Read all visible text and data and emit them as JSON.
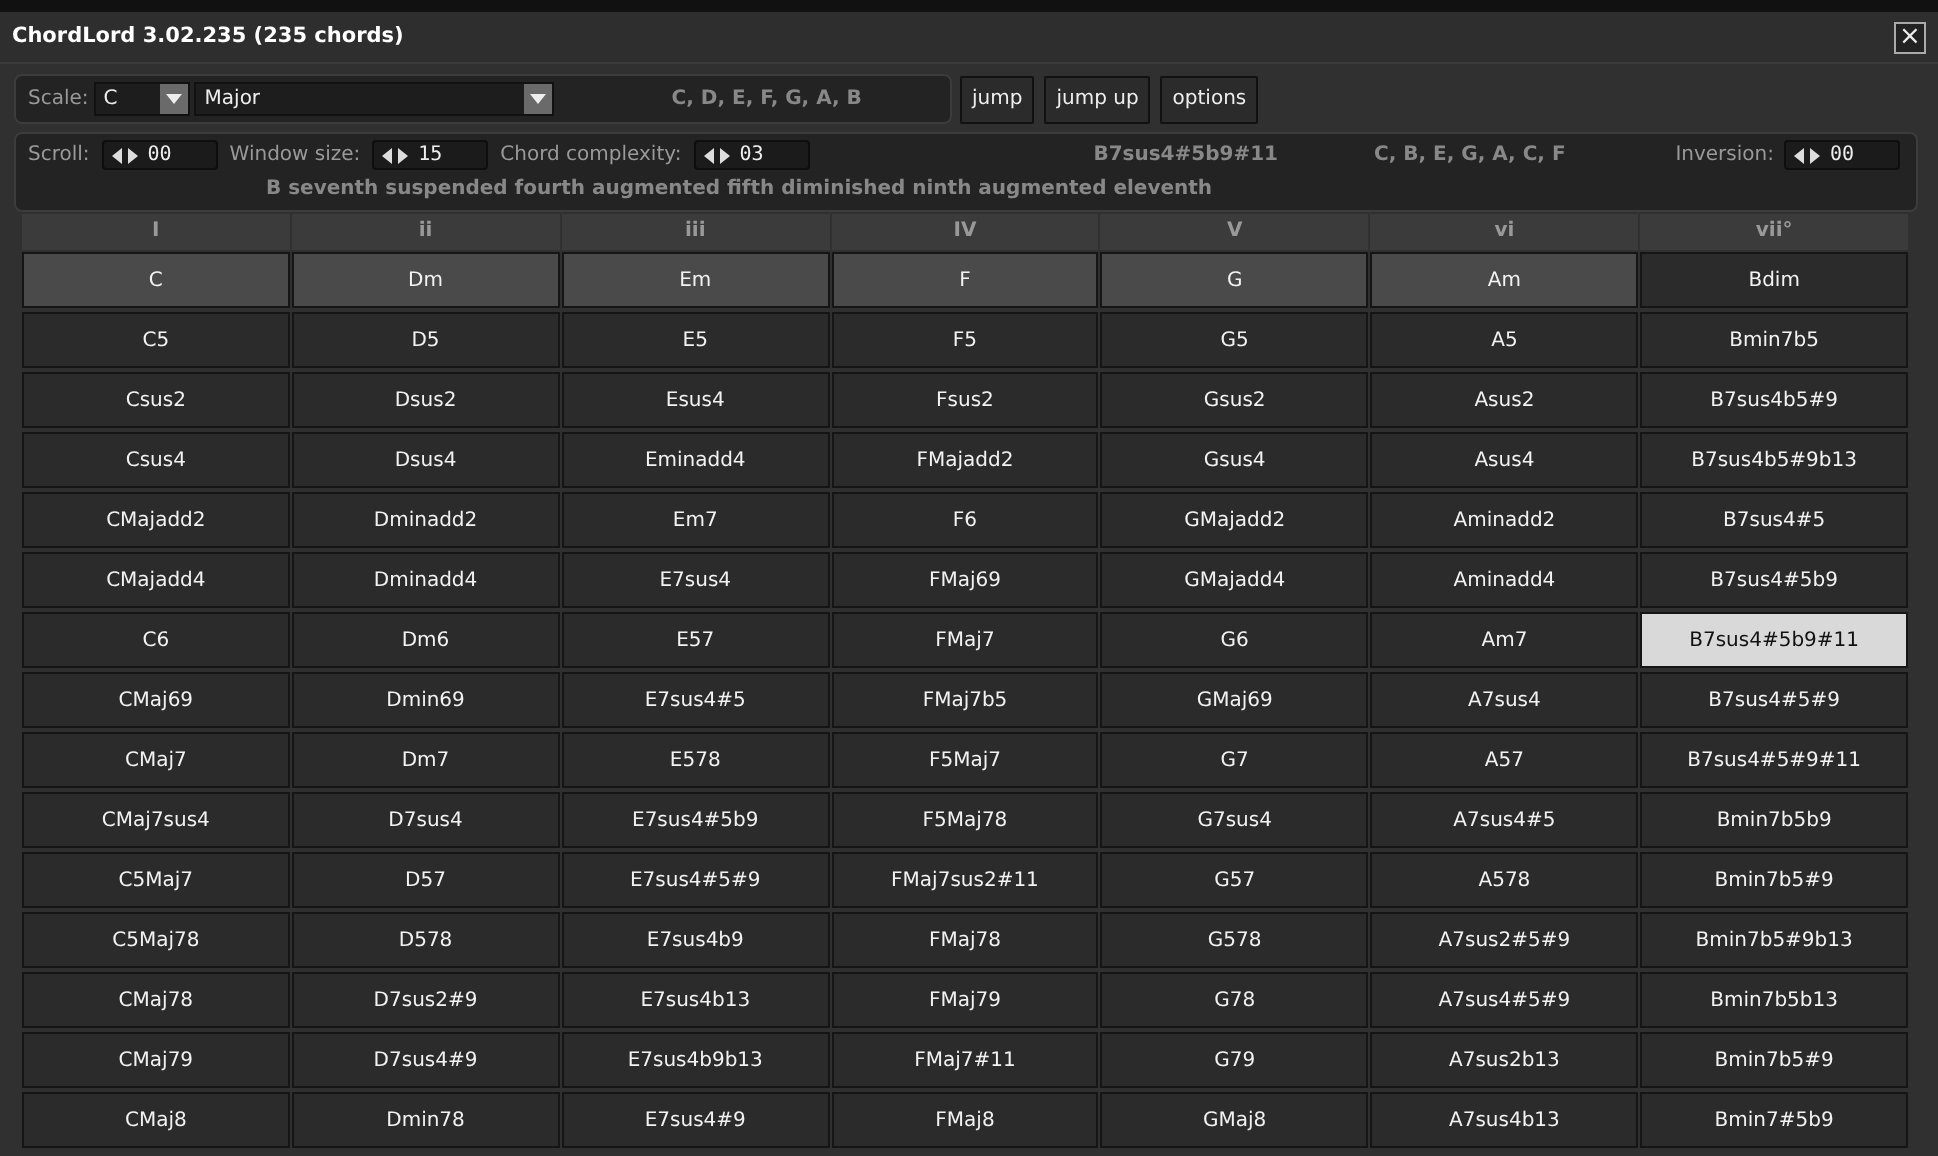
{
  "window": {
    "title": "ChordLord 3.02.235 (235 chords)",
    "close": "×"
  },
  "scale_bar": {
    "label": "Scale:",
    "root": "C",
    "mode": "Major",
    "notes": "C, D, E, F, G, A, B"
  },
  "buttons": [
    "jump",
    "jump up",
    "options"
  ],
  "controls": [
    {
      "label": "Scroll:",
      "value": "00"
    },
    {
      "label": "Window size:",
      "value": "15"
    },
    {
      "label": "Chord complexity:",
      "value": "03"
    }
  ],
  "current_chord": {
    "name": "B7sus4#5b9#11",
    "notes": "C, B, E, G, A, C, F",
    "description": "B seventh suspended fourth augmented fifth diminished ninth augmented eleventh"
  },
  "inversion": {
    "label": "Inversion:",
    "value": "00"
  },
  "columns": [
    {
      "heading": "I",
      "chords": [
        {
          "chord": "C",
          "highlighted": true,
          "selected": false
        },
        {
          "chord": "C5",
          "highlighted": false,
          "selected": false
        },
        {
          "chord": "Csus2",
          "highlighted": false,
          "selected": false
        },
        {
          "chord": "Csus4",
          "highlighted": false,
          "selected": false
        },
        {
          "chord": "CMajadd2",
          "highlighted": false,
          "selected": false
        },
        {
          "chord": "CMajadd4",
          "highlighted": false,
          "selected": false
        },
        {
          "chord": "C6",
          "highlighted": false,
          "selected": false
        },
        {
          "chord": "CMaj69",
          "highlighted": false,
          "selected": false
        },
        {
          "chord": "CMaj7",
          "highlighted": false,
          "selected": false
        },
        {
          "chord": "CMaj7sus4",
          "highlighted": false,
          "selected": false
        },
        {
          "chord": "C5Maj7",
          "highlighted": false,
          "selected": false
        },
        {
          "chord": "C5Maj78",
          "highlighted": false,
          "selected": false
        },
        {
          "chord": "CMaj78",
          "highlighted": false,
          "selected": false
        },
        {
          "chord": "CMaj79",
          "highlighted": false,
          "selected": false
        },
        {
          "chord": "CMaj8",
          "highlighted": false,
          "selected": false
        }
      ]
    },
    {
      "heading": "ii",
      "chords": [
        {
          "chord": "Dm",
          "highlighted": true,
          "selected": false
        },
        {
          "chord": "D5",
          "highlighted": false,
          "selected": false
        },
        {
          "chord": "Dsus2",
          "highlighted": false,
          "selected": false
        },
        {
          "chord": "Dsus4",
          "highlighted": false,
          "selected": false
        },
        {
          "chord": "Dminadd2",
          "highlighted": false,
          "selected": false
        },
        {
          "chord": "Dminadd4",
          "highlighted": false,
          "selected": false
        },
        {
          "chord": "Dm6",
          "highlighted": false,
          "selected": false
        },
        {
          "chord": "Dmin69",
          "highlighted": false,
          "selected": false
        },
        {
          "chord": "Dm7",
          "highlighted": false,
          "selected": false
        },
        {
          "chord": "D7sus4",
          "highlighted": false,
          "selected": false
        },
        {
          "chord": "D57",
          "highlighted": false,
          "selected": false
        },
        {
          "chord": "D578",
          "highlighted": false,
          "selected": false
        },
        {
          "chord": "D7sus2#9",
          "highlighted": false,
          "selected": false
        },
        {
          "chord": "D7sus4#9",
          "highlighted": false,
          "selected": false
        },
        {
          "chord": "Dmin78",
          "highlighted": false,
          "selected": false
        }
      ]
    },
    {
      "heading": "iii",
      "chords": [
        {
          "chord": "Em",
          "highlighted": true,
          "selected": false
        },
        {
          "chord": "E5",
          "highlighted": false,
          "selected": false
        },
        {
          "chord": "Esus4",
          "highlighted": false,
          "selected": false
        },
        {
          "chord": "Eminadd4",
          "highlighted": false,
          "selected": false
        },
        {
          "chord": "Em7",
          "highlighted": false,
          "selected": false
        },
        {
          "chord": "E7sus4",
          "highlighted": false,
          "selected": false
        },
        {
          "chord": "E57",
          "highlighted": false,
          "selected": false
        },
        {
          "chord": "E7sus4#5",
          "highlighted": false,
          "selected": false
        },
        {
          "chord": "E578",
          "highlighted": false,
          "selected": false
        },
        {
          "chord": "E7sus4#5b9",
          "highlighted": false,
          "selected": false
        },
        {
          "chord": "E7sus4#5#9",
          "highlighted": false,
          "selected": false
        },
        {
          "chord": "E7sus4b9",
          "highlighted": false,
          "selected": false
        },
        {
          "chord": "E7sus4b13",
          "highlighted": false,
          "selected": false
        },
        {
          "chord": "E7sus4b9b13",
          "highlighted": false,
          "selected": false
        },
        {
          "chord": "E7sus4#9",
          "highlighted": false,
          "selected": false
        }
      ]
    },
    {
      "heading": "IV",
      "chords": [
        {
          "chord": "F",
          "highlighted": true,
          "selected": false
        },
        {
          "chord": "F5",
          "highlighted": false,
          "selected": false
        },
        {
          "chord": "Fsus2",
          "highlighted": false,
          "selected": false
        },
        {
          "chord": "FMajadd2",
          "highlighted": false,
          "selected": false
        },
        {
          "chord": "F6",
          "highlighted": false,
          "selected": false
        },
        {
          "chord": "FMaj69",
          "highlighted": false,
          "selected": false
        },
        {
          "chord": "FMaj7",
          "highlighted": false,
          "selected": false
        },
        {
          "chord": "FMaj7b5",
          "highlighted": false,
          "selected": false
        },
        {
          "chord": "F5Maj7",
          "highlighted": false,
          "selected": false
        },
        {
          "chord": "F5Maj78",
          "highlighted": false,
          "selected": false
        },
        {
          "chord": "FMaj7sus2#11",
          "highlighted": false,
          "selected": false
        },
        {
          "chord": "FMaj78",
          "highlighted": false,
          "selected": false
        },
        {
          "chord": "FMaj79",
          "highlighted": false,
          "selected": false
        },
        {
          "chord": "FMaj7#11",
          "highlighted": false,
          "selected": false
        },
        {
          "chord": "FMaj8",
          "highlighted": false,
          "selected": false
        }
      ]
    },
    {
      "heading": "V",
      "chords": [
        {
          "chord": "G",
          "highlighted": true,
          "selected": false
        },
        {
          "chord": "G5",
          "highlighted": false,
          "selected": false
        },
        {
          "chord": "Gsus2",
          "highlighted": false,
          "selected": false
        },
        {
          "chord": "Gsus4",
          "highlighted": false,
          "selected": false
        },
        {
          "chord": "GMajadd2",
          "highlighted": false,
          "selected": false
        },
        {
          "chord": "GMajadd4",
          "highlighted": false,
          "selected": false
        },
        {
          "chord": "G6",
          "highlighted": false,
          "selected": false
        },
        {
          "chord": "GMaj69",
          "highlighted": false,
          "selected": false
        },
        {
          "chord": "G7",
          "highlighted": false,
          "selected": false
        },
        {
          "chord": "G7sus4",
          "highlighted": false,
          "selected": false
        },
        {
          "chord": "G57",
          "highlighted": false,
          "selected": false
        },
        {
          "chord": "G578",
          "highlighted": false,
          "selected": false
        },
        {
          "chord": "G78",
          "highlighted": false,
          "selected": false
        },
        {
          "chord": "G79",
          "highlighted": false,
          "selected": false
        },
        {
          "chord": "GMaj8",
          "highlighted": false,
          "selected": false
        }
      ]
    },
    {
      "heading": "vi",
      "chords": [
        {
          "chord": "Am",
          "highlighted": true,
          "selected": false
        },
        {
          "chord": "A5",
          "highlighted": false,
          "selected": false
        },
        {
          "chord": "Asus2",
          "highlighted": false,
          "selected": false
        },
        {
          "chord": "Asus4",
          "highlighted": false,
          "selected": false
        },
        {
          "chord": "Aminadd2",
          "highlighted": false,
          "selected": false
        },
        {
          "chord": "Aminadd4",
          "highlighted": false,
          "selected": false
        },
        {
          "chord": "Am7",
          "highlighted": false,
          "selected": false
        },
        {
          "chord": "A7sus4",
          "highlighted": false,
          "selected": false
        },
        {
          "chord": "A57",
          "highlighted": false,
          "selected": false
        },
        {
          "chord": "A7sus4#5",
          "highlighted": false,
          "selected": false
        },
        {
          "chord": "A578",
          "highlighted": false,
          "selected": false
        },
        {
          "chord": "A7sus2#5#9",
          "highlighted": false,
          "selected": false
        },
        {
          "chord": "A7sus4#5#9",
          "highlighted": false,
          "selected": false
        },
        {
          "chord": "A7sus2b13",
          "highlighted": false,
          "selected": false
        },
        {
          "chord": "A7sus4b13",
          "highlighted": false,
          "selected": false
        }
      ]
    },
    {
      "heading": "vii°",
      "chords": [
        {
          "chord": "Bdim",
          "highlighted": false,
          "selected": false
        },
        {
          "chord": "Bmin7b5",
          "highlighted": false,
          "selected": false
        },
        {
          "chord": "B7sus4b5#9",
          "highlighted": false,
          "selected": false
        },
        {
          "chord": "B7sus4b5#9b13",
          "highlighted": false,
          "selected": false
        },
        {
          "chord": "B7sus4#5",
          "highlighted": false,
          "selected": false
        },
        {
          "chord": "B7sus4#5b9",
          "highlighted": false,
          "selected": false
        },
        {
          "chord": "B7sus4#5b9#11",
          "highlighted": false,
          "selected": true
        },
        {
          "chord": "B7sus4#5#9",
          "highlighted": false,
          "selected": false
        },
        {
          "chord": "B7sus4#5#9#11",
          "highlighted": false,
          "selected": false
        },
        {
          "chord": "Bmin7b5b9",
          "highlighted": false,
          "selected": false
        },
        {
          "chord": "Bmin7b5#9",
          "highlighted": false,
          "selected": false
        },
        {
          "chord": "Bmin7b5#9b13",
          "highlighted": false,
          "selected": false
        },
        {
          "chord": "Bmin7b5b13",
          "highlighted": false,
          "selected": false
        },
        {
          "chord": "Bmin7b5#9",
          "highlighted": false,
          "selected": false
        },
        {
          "chord": "Bmin7#5b9",
          "highlighted": false,
          "selected": false
        }
      ]
    }
  ]
}
